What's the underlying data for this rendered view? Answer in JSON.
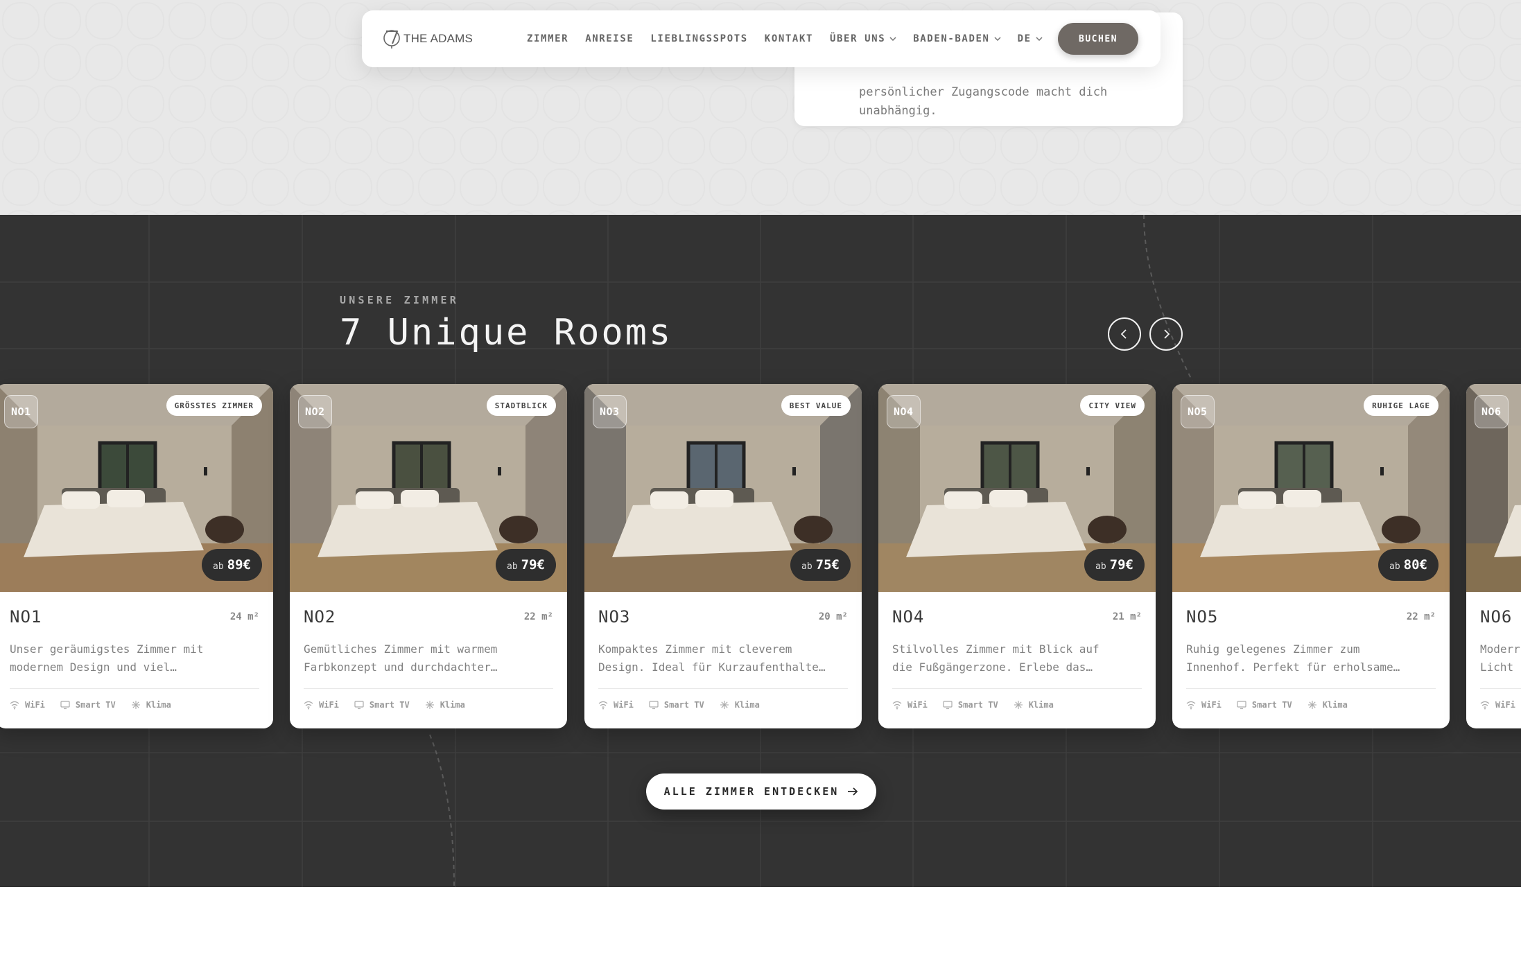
{
  "brand": {
    "name": "THE ADAMS",
    "logo_icon": "key-7-icon"
  },
  "nav": {
    "links": [
      {
        "label": "ZIMMER",
        "dropdown": false
      },
      {
        "label": "ANREISE",
        "dropdown": false
      },
      {
        "label": "LIEBLINGSSPOTS",
        "dropdown": false
      },
      {
        "label": "KONTAKT",
        "dropdown": false
      },
      {
        "label": "ÜBER UNS",
        "dropdown": true
      },
      {
        "label": "BADEN-BADEN",
        "dropdown": true
      },
      {
        "label": "DE",
        "dropdown": true
      }
    ],
    "cta": "BUCHEN"
  },
  "info_card": {
    "text_line1": "persönlicher Zugangscode macht dich",
    "text_line2": "unabhängig."
  },
  "rooms_section": {
    "eyebrow": "UNSERE ZIMMER",
    "heading": "7 Unique Rooms",
    "prev_icon": "chevron-left-icon",
    "next_icon": "chevron-right-icon",
    "cta_label": "ALLE ZIMMER ENTDECKEN"
  },
  "rooms": [
    {
      "badge": "NO1",
      "tag": "GRÖSSTES ZIMMER",
      "price_prefix": "ab",
      "price": "89€",
      "title": "NO1",
      "size": "24 m²",
      "desc1": "Unser geräumigstes Zimmer mit",
      "desc2": "modernem Design und viel…",
      "amenities": [
        "WiFi",
        "Smart TV",
        "Klima"
      ]
    },
    {
      "badge": "NO2",
      "tag": "STADTBLICK",
      "price_prefix": "ab",
      "price": "79€",
      "title": "NO2",
      "size": "22 m²",
      "desc1": "Gemütliches Zimmer mit warmem",
      "desc2": "Farbkonzept und durchdachter…",
      "amenities": [
        "WiFi",
        "Smart TV",
        "Klima"
      ]
    },
    {
      "badge": "NO3",
      "tag": "BEST VALUE",
      "price_prefix": "ab",
      "price": "75€",
      "title": "NO3",
      "size": "20 m²",
      "desc1": "Kompaktes Zimmer mit cleverem",
      "desc2": "Design. Ideal für Kurzaufenthalte…",
      "amenities": [
        "WiFi",
        "Smart TV",
        "Klima"
      ]
    },
    {
      "badge": "NO4",
      "tag": "CITY VIEW",
      "price_prefix": "ab",
      "price": "79€",
      "title": "NO4",
      "size": "21 m²",
      "desc1": "Stilvolles Zimmer mit Blick auf",
      "desc2": "die Fußgängerzone. Erlebe das…",
      "amenities": [
        "WiFi",
        "Smart TV",
        "Klima"
      ]
    },
    {
      "badge": "NO5",
      "tag": "RUHIGE LAGE",
      "price_prefix": "ab",
      "price": "80€",
      "title": "NO5",
      "size": "22 m²",
      "desc1": "Ruhig gelegenes Zimmer zum",
      "desc2": "Innenhof. Perfekt für erholsame…",
      "amenities": [
        "WiFi",
        "Smart TV",
        "Klima"
      ]
    },
    {
      "badge": "NO6",
      "tag": "",
      "price_prefix": "",
      "price": "",
      "title": "NO6",
      "size": "",
      "desc1": "Moderr",
      "desc2": "Licht",
      "amenities": [
        "WiFi"
      ]
    }
  ],
  "colors": {
    "dark_bg": "#333333",
    "light_bg": "#e8e8e8",
    "cta_brown": "#6f6964"
  }
}
